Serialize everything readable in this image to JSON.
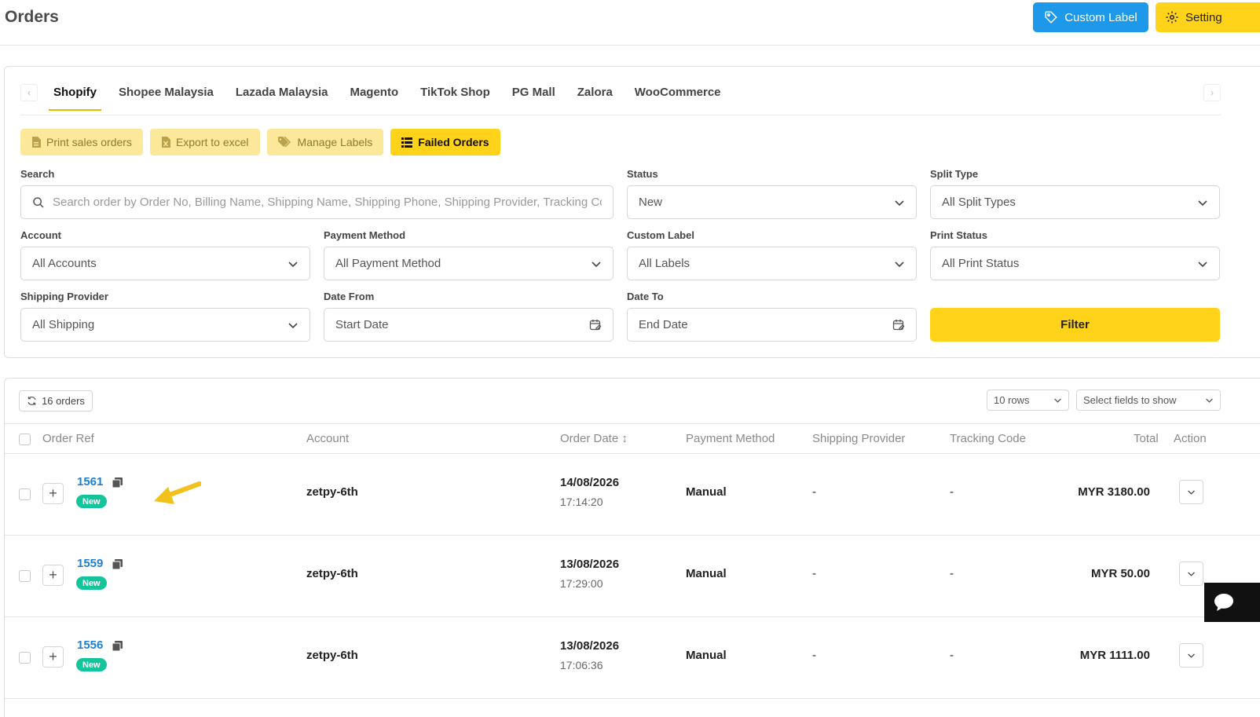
{
  "header": {
    "title": "Orders",
    "custom_label_btn": "Custom Label",
    "setting_btn": "Setting"
  },
  "tabs": [
    {
      "label": "Shopify",
      "active": true
    },
    {
      "label": "Shopee Malaysia"
    },
    {
      "label": "Lazada Malaysia"
    },
    {
      "label": "Magento"
    },
    {
      "label": "TikTok Shop"
    },
    {
      "label": "PG Mall"
    },
    {
      "label": "Zalora"
    },
    {
      "label": "WooCommerce"
    }
  ],
  "actions": {
    "print": "Print sales orders",
    "export": "Export to excel",
    "manage": "Manage Labels",
    "failed": "Failed Orders"
  },
  "filters": {
    "search_label": "Search",
    "search_placeholder": "Search order by Order No, Billing Name, Shipping Name, Shipping Phone, Shipping Provider, Tracking Code",
    "status_label": "Status",
    "status_value": "New",
    "split_label": "Split Type",
    "split_value": "All Split Types",
    "account_label": "Account",
    "account_value": "All Accounts",
    "payment_label": "Payment Method",
    "payment_value": "All Payment Method",
    "custom_label_label": "Custom Label",
    "custom_label_value": "All Labels",
    "print_status_label": "Print Status",
    "print_status_value": "All Print Status",
    "shipping_label": "Shipping Provider",
    "shipping_value": "All Shipping",
    "date_from_label": "Date From",
    "date_from_placeholder": "Start Date",
    "date_to_label": "Date To",
    "date_to_placeholder": "End Date",
    "filter_btn": "Filter"
  },
  "table": {
    "orders_count": "16 orders",
    "rows_select": "10 rows",
    "fields_select": "Select fields to show",
    "columns": {
      "order_ref": "Order Ref",
      "account": "Account",
      "order_date": "Order Date ↕",
      "payment": "Payment Method",
      "shipping": "Shipping Provider",
      "tracking": "Tracking Code",
      "total": "Total",
      "action": "Action"
    },
    "rows": [
      {
        "ref": "1561",
        "status": "New",
        "account": "zetpy-6th",
        "date": "14/08/2026",
        "time": "17:14:20",
        "payment": "Manual",
        "shipping": "-",
        "tracking": "-",
        "total": "MYR 3180.00"
      },
      {
        "ref": "1559",
        "status": "New",
        "account": "zetpy-6th",
        "date": "13/08/2026",
        "time": "17:29:00",
        "payment": "Manual",
        "shipping": "-",
        "tracking": "-",
        "total": "MYR 50.00"
      },
      {
        "ref": "1556",
        "status": "New",
        "account": "zetpy-6th",
        "date": "13/08/2026",
        "time": "17:06:36",
        "payment": "Manual",
        "shipping": "-",
        "tracking": "-",
        "total": "MYR 1111.00"
      }
    ]
  },
  "colors": {
    "primary_yellow": "#ffd31a",
    "blue": "#1e98e8",
    "badge_green": "#14c49a",
    "link_blue": "#1e7fd1"
  }
}
